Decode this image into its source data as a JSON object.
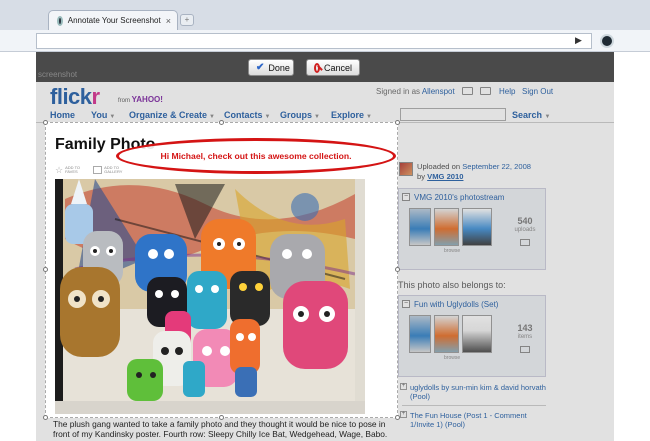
{
  "browser": {
    "tab_title": "Annotate Your Screenshot",
    "tab_close": "×",
    "new_tab": "+",
    "go": "▶"
  },
  "annotate_toolbar": {
    "watermark": "screenshot",
    "done_label": "Done",
    "cancel_label": "Cancel"
  },
  "flickr": {
    "logo_flick": "flick",
    "logo_r": "r",
    "from": "from",
    "yahoo": "YAHOO!",
    "signed_in_prefix": "Signed in as",
    "username": "Allenspot",
    "help": "Help",
    "sign_out": "Sign Out",
    "nav": [
      {
        "label": "Home",
        "caret": ""
      },
      {
        "label": "You",
        "caret": "▼"
      },
      {
        "label": "Organize & Create",
        "caret": "▼"
      },
      {
        "label": "Contacts",
        "caret": "▼"
      },
      {
        "label": "Groups",
        "caret": "▼"
      },
      {
        "label": "Explore",
        "caret": "▼"
      }
    ],
    "search_label": "Search",
    "search_caret": "▼"
  },
  "photo": {
    "title": "Family Photo",
    "add_faves": "ADD TO FAVES",
    "add_gallery": "ADD TO GALLERY",
    "caption": "The plush gang wanted to take a family photo and they thought it would be nice to pose in front of my Kandinsky poster. Fourth row: Sleepy Chilly Ice Bat, Wedgehead, Wage, Babo."
  },
  "annotation": {
    "text": "Hi Michael, check out this awesome collection.",
    "color": "#d41414"
  },
  "sidebar": {
    "uploaded_prefix": "Uploaded on",
    "uploaded_date": "September 22, 2008",
    "by_prefix": "by",
    "author": "VMG 2010",
    "photostream": {
      "title": "VMG 2010's photostream",
      "count": "540",
      "count_label": "uploads",
      "strip_label": "browse"
    },
    "belongs_heading": "This photo also belongs to:",
    "set": {
      "title": "Fun with Uglydolls (Set)",
      "count": "143",
      "count_label": "items",
      "strip_label": "browse"
    },
    "pools": [
      {
        "text": "uglydolls by sun-min kim & david horvath (Pool)"
      },
      {
        "text": "The Fun House (Post 1 - Comment 1/Invite 1) (Pool)"
      }
    ]
  }
}
